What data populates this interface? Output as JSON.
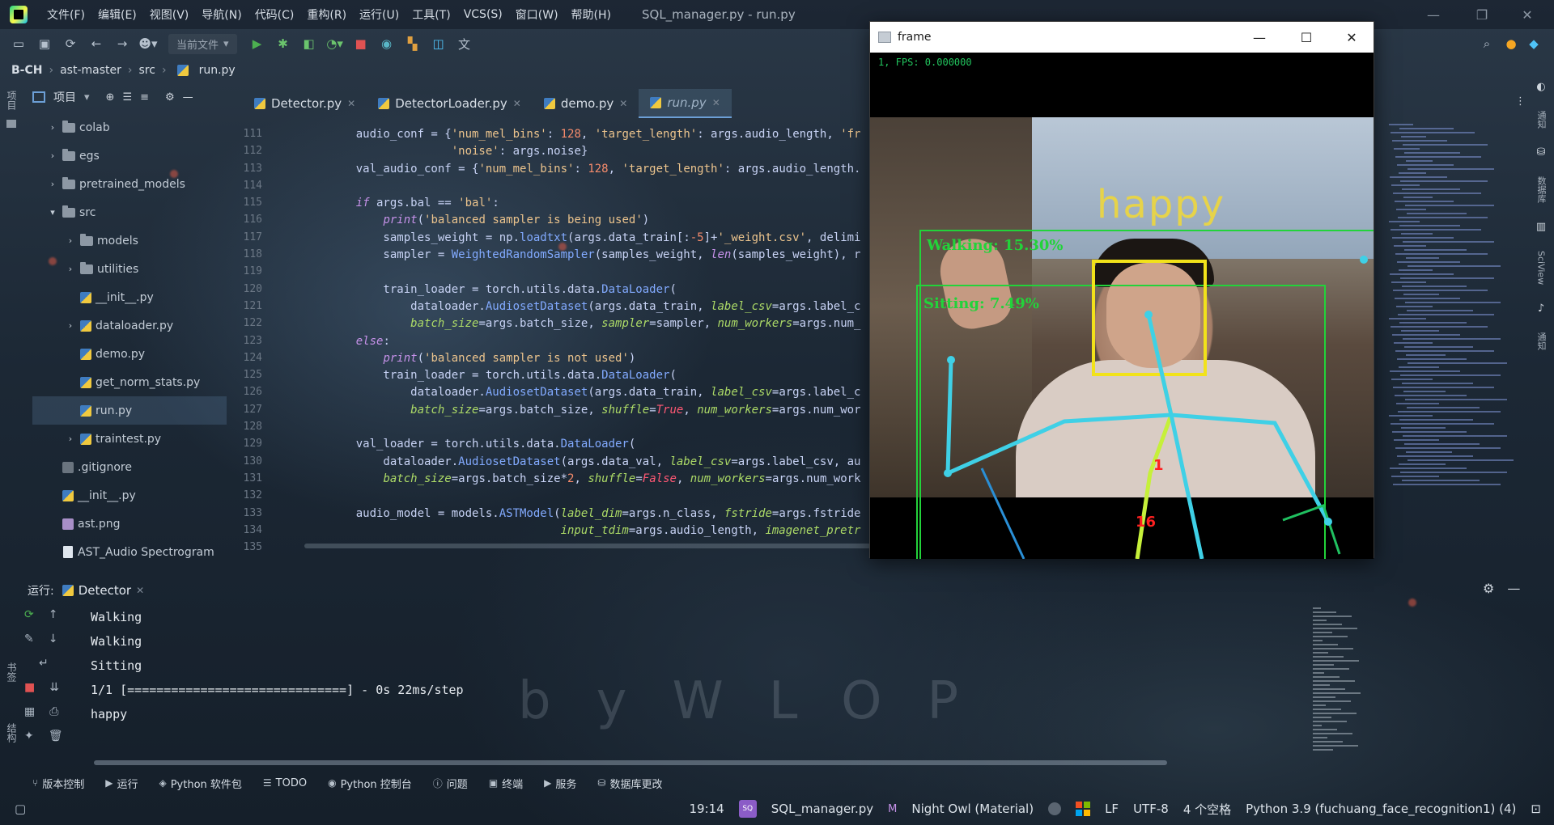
{
  "menubar": {
    "items": [
      "文件(F)",
      "编辑(E)",
      "视图(V)",
      "导航(N)",
      "代码(C)",
      "重构(R)",
      "运行(U)",
      "工具(T)",
      "VCS(S)",
      "窗口(W)",
      "帮助(H)"
    ],
    "window_title": "SQL_manager.py - run.py"
  },
  "toolbar": {
    "run_config": "当前文件",
    "icons": [
      "open-icon",
      "save-icon",
      "sync-icon",
      "back-icon",
      "forward-icon",
      "user-icon",
      "run-icon",
      "debug-icon",
      "coverage-icon",
      "profile-icon",
      "stop-icon",
      "search-everywhere-icon",
      "plugin-icon",
      "sciview-icon",
      "translate-icon"
    ]
  },
  "breadcrumb": [
    "B-CH",
    "ast-master",
    "src",
    "run.py"
  ],
  "left_strip": {
    "project_label": "项目",
    "bookmarks_label": "书签",
    "structure_label": "结构"
  },
  "project_panel": {
    "title": "项目",
    "tree": [
      {
        "label": "colab",
        "type": "folder",
        "indent": 1,
        "expandable": true,
        "expanded": false
      },
      {
        "label": "egs",
        "type": "folder",
        "indent": 1,
        "expandable": true,
        "expanded": false
      },
      {
        "label": "pretrained_models",
        "type": "folder",
        "indent": 1,
        "expandable": true,
        "expanded": false
      },
      {
        "label": "src",
        "type": "folder",
        "indent": 1,
        "expandable": true,
        "expanded": true
      },
      {
        "label": "models",
        "type": "folder",
        "indent": 2,
        "expandable": true,
        "expanded": false
      },
      {
        "label": "utilities",
        "type": "folder",
        "indent": 2,
        "expandable": true,
        "expanded": false
      },
      {
        "label": "__init__.py",
        "type": "py",
        "indent": 2,
        "expandable": false
      },
      {
        "label": "dataloader.py",
        "type": "py",
        "indent": 2,
        "expandable": true,
        "expanded": false
      },
      {
        "label": "demo.py",
        "type": "py",
        "indent": 2,
        "expandable": false
      },
      {
        "label": "get_norm_stats.py",
        "type": "py",
        "indent": 2,
        "expandable": false
      },
      {
        "label": "run.py",
        "type": "py",
        "indent": 2,
        "expandable": false,
        "selected": true
      },
      {
        "label": "traintest.py",
        "type": "py",
        "indent": 2,
        "expandable": true,
        "expanded": false
      },
      {
        "label": ".gitignore",
        "type": "git",
        "indent": 1,
        "expandable": false
      },
      {
        "label": "__init__.py",
        "type": "py",
        "indent": 1,
        "expandable": false
      },
      {
        "label": "ast.png",
        "type": "img",
        "indent": 1,
        "expandable": false
      },
      {
        "label": "AST_Audio Spectrogram",
        "type": "doc",
        "indent": 1,
        "expandable": false
      }
    ]
  },
  "tabs": [
    {
      "label": "Detector.py",
      "active": false
    },
    {
      "label": "DetectorLoader.py",
      "active": false
    },
    {
      "label": "demo.py",
      "active": false
    },
    {
      "label": "run.py",
      "active": true
    }
  ],
  "editor": {
    "lines": [
      {
        "n": "111",
        "html": "    audio_conf = {<span class='str'>'num_mel_bins'</span>: <span class='num'>128</span>, <span class='str'>'target_length'</span>: args.audio_length, <span class='str'>'fr</span>"
      },
      {
        "n": "112",
        "html": "                  <span class='str'>'noise'</span>: args.noise}"
      },
      {
        "n": "113",
        "html": "    val_audio_conf = {<span class='str'>'num_mel_bins'</span>: <span class='num'>128</span>, <span class='str'>'target_length'</span>: args.audio_length."
      },
      {
        "n": "114",
        "html": ""
      },
      {
        "n": "115",
        "html": "    <span class='kw'>if</span> args.bal == <span class='str'>'bal'</span>:"
      },
      {
        "n": "116",
        "html": "        <span class='kw'>print</span>(<span class='str'>'balanced sampler is being used'</span>)"
      },
      {
        "n": "117",
        "html": "        samples_weight = np.<span class='fn'>loadtxt</span>(args.data_train[:<span class='num'>-5</span>]+<span class='str'>'_weight.csv'</span>, delimi"
      },
      {
        "n": "118",
        "html": "        sampler = <span class='fn'>WeightedRandomSampler</span>(samples_weight, <span class='kw'>len</span>(samples_weight), r"
      },
      {
        "n": "119",
        "html": ""
      },
      {
        "n": "120",
        "html": "        train_loader = torch.utils.data.<span class='fn'>DataLoader</span>("
      },
      {
        "n": "121",
        "html": "            dataloader.<span class='fn'>AudiosetDataset</span>(args.data_train, <span class='param'>label_csv</span>=args.label_c"
      },
      {
        "n": "122",
        "html": "            <span class='param'>batch_size</span>=args.batch_size, <span class='param'>sampler</span>=sampler, <span class='param'>num_workers</span>=args.num_"
      },
      {
        "n": "123",
        "html": "    <span class='kw'>else</span>:"
      },
      {
        "n": "124",
        "html": "        <span class='kw'>print</span>(<span class='str'>'balanced sampler is not used'</span>)"
      },
      {
        "n": "125",
        "html": "        train_loader = torch.utils.data.<span class='fn'>DataLoader</span>("
      },
      {
        "n": "126",
        "html": "            dataloader.<span class='fn'>AudiosetDataset</span>(args.data_train, <span class='param'>label_csv</span>=args.label_c"
      },
      {
        "n": "127",
        "html": "            <span class='param'>batch_size</span>=args.batch_size, <span class='param'>shuffle</span>=<span class='bool'>True</span>, <span class='param'>num_workers</span>=args.num_wor"
      },
      {
        "n": "128",
        "html": ""
      },
      {
        "n": "129",
        "html": "    val_loader = torch.utils.data.<span class='fn'>DataLoader</span>("
      },
      {
        "n": "130",
        "html": "        dataloader.<span class='fn'>AudiosetDataset</span>(args.data_val, <span class='param'>label_csv</span>=args.label_csv, au"
      },
      {
        "n": "131",
        "html": "        <span class='param'>batch_size</span>=args.batch_size*<span class='num'>2</span>, <span class='param'>shuffle</span>=<span class='bool'>False</span>, <span class='param'>num_workers</span>=args.num_work"
      },
      {
        "n": "132",
        "html": ""
      },
      {
        "n": "133",
        "html": "    audio_model = models.<span class='fn'>ASTModel</span>(<span class='param'>label_dim</span>=args.n_class, <span class='param'>fstride</span>=args.fstride"
      },
      {
        "n": "134",
        "html": "                                  <span class='param'>input_tdim</span>=args.audio_length, <span class='param'>imagenet_pretr</span>"
      },
      {
        "n": "135",
        "html": ""
      }
    ]
  },
  "frame_window": {
    "title": "frame",
    "fps_text": "1, FPS: 0.000000",
    "emotion_label": "happy",
    "action_labels": [
      "Walking: 15.30%",
      "Sitting: 7.49%"
    ],
    "keypoint_labels": [
      "1",
      "16"
    ]
  },
  "right_strip": [
    "通知",
    "数据库",
    "SciView",
    "通知"
  ],
  "run_panel": {
    "label": "运行:",
    "config_name": "Detector",
    "console": [
      "Walking",
      "Walking",
      "Sitting",
      "1/1 [==============================] - 0s 22ms/step",
      "happy"
    ]
  },
  "bottom_tabs": [
    {
      "icon": "⑂",
      "label": "版本控制"
    },
    {
      "icon": "▶",
      "label": "运行"
    },
    {
      "icon": "◈",
      "label": "Python 软件包"
    },
    {
      "icon": "☰",
      "label": "TODO"
    },
    {
      "icon": "◉",
      "label": "Python 控制台"
    },
    {
      "icon": "ⓘ",
      "label": "问题"
    },
    {
      "icon": "▣",
      "label": "终端"
    },
    {
      "icon": "▶",
      "label": "服务"
    },
    {
      "icon": "⛁",
      "label": "数据库更改"
    }
  ],
  "statusbar": {
    "cursor": "19:14",
    "sq_badge": "SQ",
    "file": "SQL_manager.py",
    "theme": "Night Owl (Material)",
    "line_sep": "LF",
    "encoding": "UTF-8",
    "indent": "4 个空格",
    "interpreter": "Python 3.9 (fuchuang_face_recognition1) (4)"
  },
  "wallpaper_text": "byWLOP",
  "colors": {
    "accent": "#6c9fd6",
    "keyword": "#c792ea",
    "string": "#ecc48d",
    "function": "#82aaff",
    "skeleton": "#3fd0e6",
    "detection_box": "#22d33a",
    "face_box": "#f2e21a"
  }
}
